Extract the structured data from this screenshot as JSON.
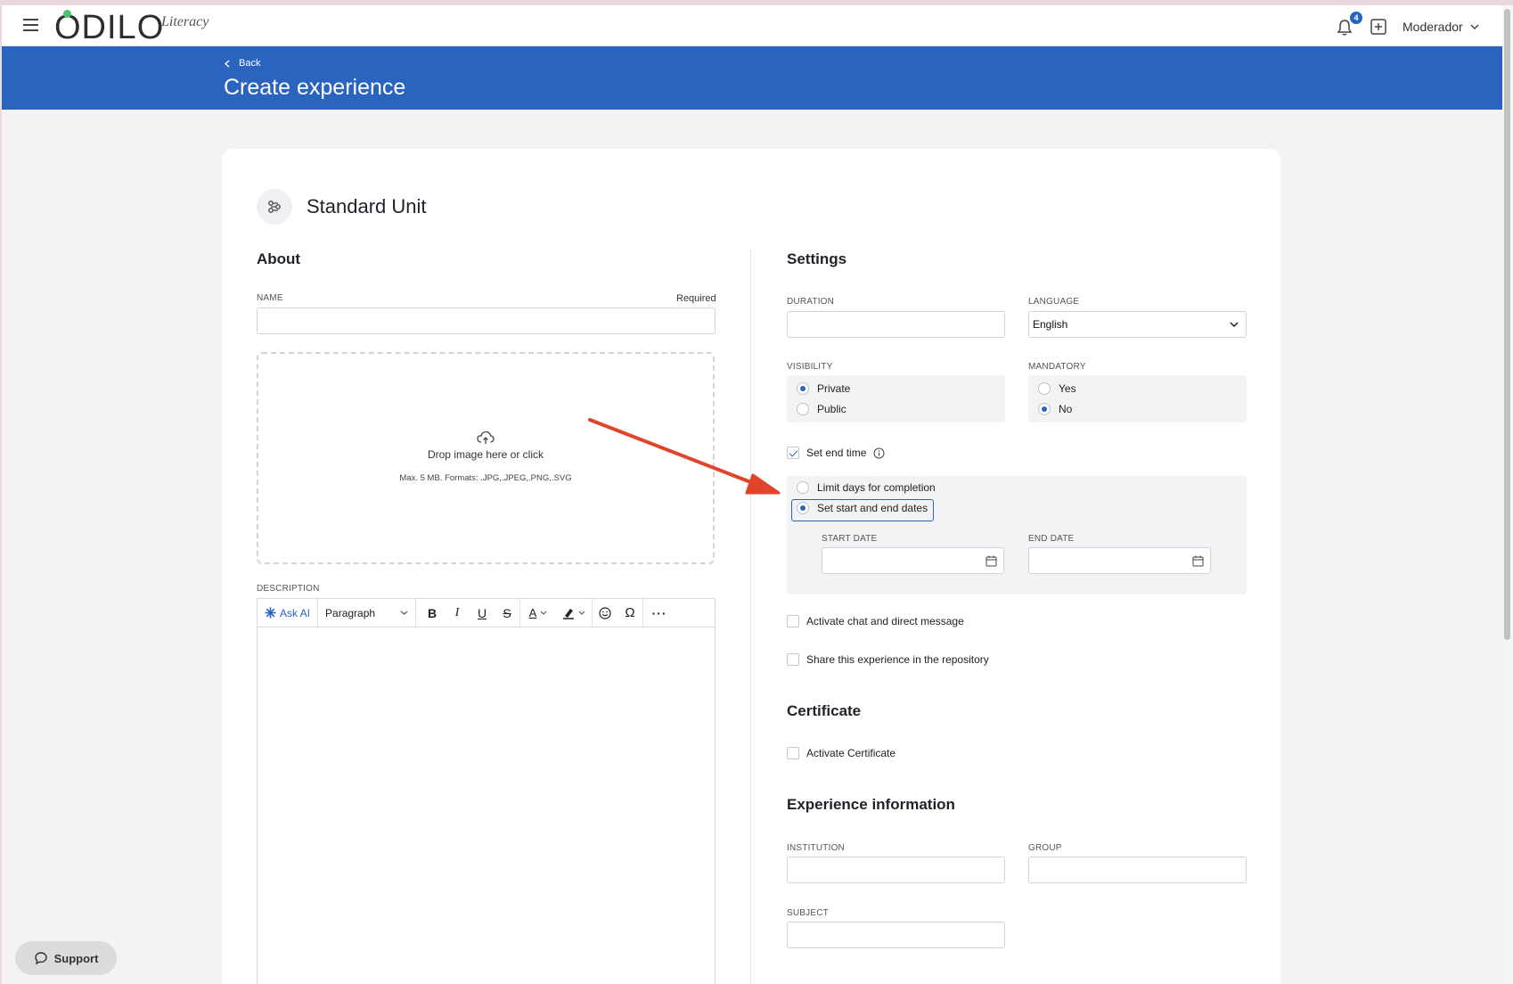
{
  "topbar": {
    "logo_text": "ODILO",
    "logo_sub": "Literacy",
    "notifications_count": "4",
    "user_name": "Moderador"
  },
  "header": {
    "back_label": "Back",
    "title": "Create experience"
  },
  "unit": {
    "title": "Standard Unit"
  },
  "about": {
    "heading": "About",
    "name_label": "NAME",
    "required_label": "Required",
    "name_value": "",
    "dropzone_text": "Drop image here or click",
    "dropzone_hint": "Max. 5 MB. Formats: .JPG,.JPEG,.PNG,.SVG",
    "description_label": "DESCRIPTION",
    "editor": {
      "ask_ai": "Ask AI",
      "paragraph": "Paragraph"
    }
  },
  "settings": {
    "heading": "Settings",
    "duration_label": "DURATION",
    "duration_value": "",
    "language_label": "LANGUAGE",
    "language_value": "English",
    "visibility_label": "VISIBILITY",
    "visibility_options": [
      "Private",
      "Public"
    ],
    "visibility_selected": "Private",
    "mandatory_label": "MANDATORY",
    "mandatory_options": [
      "Yes",
      "No"
    ],
    "mandatory_selected": "No",
    "set_end_time_label": "Set end time",
    "set_end_time_checked": true,
    "end_time_options": [
      "Limit days for completion",
      "Set start and end dates"
    ],
    "end_time_selected": "Set start and end dates",
    "start_date_label": "START DATE",
    "end_date_label": "END DATE",
    "chat_label": "Activate chat and direct message",
    "share_label": "Share this experience in the repository"
  },
  "certificate": {
    "heading": "Certificate",
    "activate_label": "Activate Certificate"
  },
  "experience_info": {
    "heading": "Experience information",
    "institution_label": "INSTITUTION",
    "group_label": "GROUP",
    "subject_label": "SUBJECT"
  },
  "support": {
    "label": "Support"
  },
  "colors": {
    "brand_blue": "#2a64be",
    "logo_green": "#4cc36a",
    "annotation_red": "#e0452b"
  }
}
